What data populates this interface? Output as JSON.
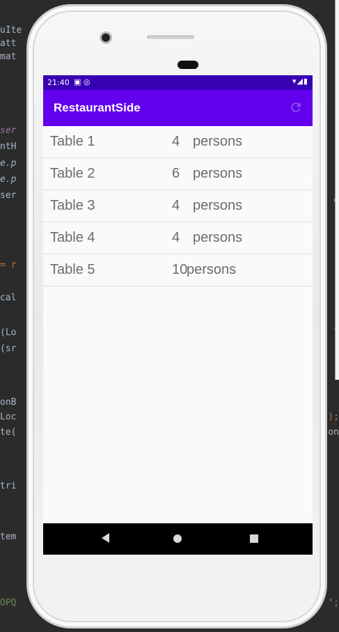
{
  "ide": {
    "left_lines": [
      "uIte",
      "att",
      "mat",
      "ser",
      "ntH",
      "e.p",
      "e.p",
      "ser",
      "= r",
      "cal",
      "(Lo",
      "(sr",
      "onB",
      "Loc",
      "te(",
      "tri",
      "tem",
      "OPQ"
    ],
    "right_lines": [
      "(",
      "e",
      "t",
      ");",
      "on",
      "\";"
    ]
  },
  "status_bar": {
    "time": "21:40",
    "left_icons": "▣ ◎",
    "right_icons": "▾◢▮"
  },
  "app_bar": {
    "title": "RestaurantSide",
    "refresh_icon": "refresh-icon"
  },
  "tables": [
    {
      "name": "Table 1",
      "count": "4",
      "unit": "persons"
    },
    {
      "name": "Table 2",
      "count": "6",
      "unit": "persons"
    },
    {
      "name": "Table 3",
      "count": "4",
      "unit": "persons"
    },
    {
      "name": "Table 4",
      "count": "4",
      "unit": "persons"
    },
    {
      "name": "Table 5",
      "count": "10",
      "unit": "persons"
    }
  ],
  "colors": {
    "status_bar": "#3700b3",
    "app_bar": "#6200ee",
    "list_text": "#6b6b6b"
  }
}
